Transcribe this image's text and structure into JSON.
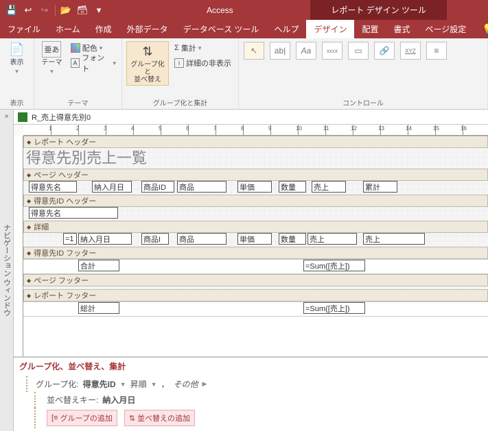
{
  "qat": {
    "save": "💾",
    "undo": "↩",
    "redo": "↪",
    "open": "📂",
    "db": "🗃",
    "more": "▾"
  },
  "title": {
    "app": "Access",
    "tool": "レポート デザイン ツール"
  },
  "tabs": {
    "file": "ファイル",
    "home": "ホーム",
    "create": "作成",
    "external": "外部データ",
    "dbtools": "データベース ツール",
    "help": "ヘルプ",
    "design": "デザイン",
    "arrange": "配置",
    "format": "書式",
    "pagesetup": "ページ設定"
  },
  "ribbon": {
    "view": {
      "label": "表示",
      "group": "表示"
    },
    "theme": {
      "label": "テーマ",
      "colors": "配色",
      "fonts": "フォント",
      "group": "テーマ",
      "aa": "亜あ"
    },
    "grouping": {
      "big": "グループ化と\n並べ替え",
      "totals": "集計",
      "hidedetail": "詳細の非表示",
      "group": "グループ化と集計"
    },
    "controls": {
      "group": "コントロール",
      "ab": "ab|",
      "aa": "Aa",
      "xxxx": "xxxx",
      "xyz": "XYZ"
    }
  },
  "object": {
    "name": "R_売上得意先別0"
  },
  "sections": {
    "reportHeader": "レポート ヘッダー",
    "pageHeader": "ページ ヘッダー",
    "groupHeader": "得意先ID ヘッダー",
    "detail": "詳細",
    "groupFooter": "得意先ID フッター",
    "pageFooter": "ページ フッター",
    "reportFooter": "レポート フッター"
  },
  "fields": {
    "reportTitle": "得意先別売上一覧",
    "hdr": {
      "c1": "得意先名",
      "c2": "納入月日",
      "c3": "商品ID",
      "c4": "商品",
      "c5": "単価",
      "c6": "数量",
      "c7": "売上",
      "c8": "累計"
    },
    "grp": {
      "name": "得意先名"
    },
    "det": {
      "rownum": "=1",
      "c2": "納入月日",
      "c3": "商品I",
      "c4": "商品",
      "c5": "単価",
      "c6": "数量",
      "c7": "売上",
      "c8": "売上"
    },
    "gfoot": {
      "label": "合計",
      "sum": "=Sum([売上])"
    },
    "rfoot": {
      "label": "総計",
      "sum": "=Sum([売上])"
    }
  },
  "nav": {
    "label": "ナビゲーション ウィンドウ",
    "chev": "»"
  },
  "gbs": {
    "title": "グループ化、並べ替え、集計",
    "groupBy": "グループ化:",
    "groupField": "得意先ID",
    "asc": "昇順",
    "comma": "，",
    "more": "その他",
    "sortKey": "並べ替えキー:",
    "sortField": "納入月日",
    "addGroup": "グループの追加",
    "addSort": "並べ替えの追加"
  },
  "ruler": {
    "nums": [
      "1",
      "2",
      "3",
      "4",
      "5",
      "6",
      "7",
      "8",
      "9",
      "10",
      "11",
      "12",
      "13",
      "14",
      "15",
      "16"
    ]
  }
}
